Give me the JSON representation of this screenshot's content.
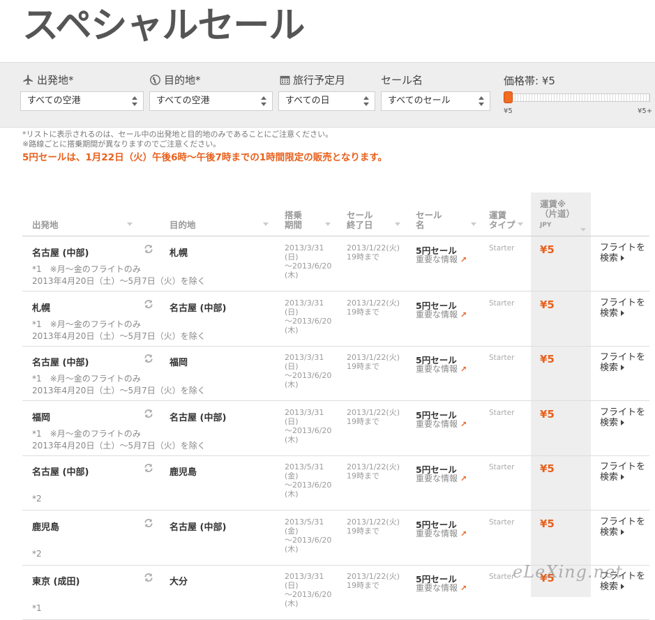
{
  "page_title": "スペシャルセール",
  "filters": {
    "origin": {
      "label": "出発地*",
      "value": "すべての空港"
    },
    "destination": {
      "label": "目的地*",
      "value": "すべての空港"
    },
    "travel_month": {
      "label": "旅行予定月",
      "value": "すべての日"
    },
    "sale_name": {
      "label": "セール名",
      "value": "すべてのセール"
    },
    "price": {
      "label": "価格帯: ¥5",
      "min": "¥5",
      "max": "¥5+",
      "level": 0
    }
  },
  "notes": [
    "*リストに表示されるのは、セール中の出発地と目的地のみであることにご注意ください。",
    "※路線ごとに搭乗期間が異なりますのでご注意ください。"
  ],
  "notice": "5円セールは、1月22日（火）午後6時～午後7時までの1時間限定の販売となります。",
  "table": {
    "headers": {
      "origin": "出発地",
      "destination": "目的地",
      "boarding": [
        "搭乗",
        "期間"
      ],
      "sale_end": [
        "セール",
        "終了日"
      ],
      "sale_name": [
        "セール",
        "名"
      ],
      "fare_type": [
        "運賃",
        "タイプ"
      ],
      "fare": [
        "運賃※",
        "（片道）"
      ],
      "fare_currency": "JPY"
    },
    "rows": [
      {
        "from": "名古屋 (中部)",
        "to": "札幌",
        "note1": "*1　※月～金のフライトのみ",
        "note2": "2013年4月20日（土）～5月7日（火）を除く",
        "board": [
          "2013/3/31",
          "(日)",
          "～2013/6/20",
          "(木)"
        ],
        "end": [
          "2013/1/22(火)",
          "19時まで"
        ],
        "sale": "5円セール",
        "info": "重要な情報",
        "type": "Starter",
        "fare": "¥5",
        "search": [
          "フライトを",
          "検索"
        ]
      },
      {
        "from": "札幌",
        "to": "名古屋 (中部)",
        "note1": "*1　※月～金のフライトのみ",
        "note2": "2013年4月20日（土）～5月7日（火）を除く",
        "board": [
          "2013/3/31",
          "(日)",
          "～2013/6/20",
          "(木)"
        ],
        "end": [
          "2013/1/22(火)",
          "19時まで"
        ],
        "sale": "5円セール",
        "info": "重要な情報",
        "type": "Starter",
        "fare": "¥5",
        "search": [
          "フライトを",
          "検索"
        ]
      },
      {
        "from": "名古屋 (中部)",
        "to": "福岡",
        "note1": "*1　※月～金のフライトのみ",
        "note2": "2013年4月20日（土）～5月7日（火）を除く",
        "board": [
          "2013/3/31",
          "(日)",
          "～2013/6/20",
          "(木)"
        ],
        "end": [
          "2013/1/22(火)",
          "19時まで"
        ],
        "sale": "5円セール",
        "info": "重要な情報",
        "type": "Starter",
        "fare": "¥5",
        "search": [
          "フライトを",
          "検索"
        ]
      },
      {
        "from": "福岡",
        "to": "名古屋 (中部)",
        "note1": "*1　※月～金のフライトのみ",
        "note2": "2013年4月20日（土）～5月7日（火）を除く",
        "board": [
          "2013/3/31",
          "(日)",
          "～2013/6/20",
          "(木)"
        ],
        "end": [
          "2013/1/22(火)",
          "19時まで"
        ],
        "sale": "5円セール",
        "info": "重要な情報",
        "type": "Starter",
        "fare": "¥5",
        "search": [
          "フライトを",
          "検索"
        ]
      },
      {
        "from": "名古屋 (中部)",
        "to": "鹿児島",
        "note1": "",
        "note2": "*2",
        "board": [
          "2013/5/31",
          "(金)",
          "～2013/6/20",
          "(木)"
        ],
        "end": [
          "2013/1/22(火)",
          "19時まで"
        ],
        "sale": "5円セール",
        "info": "重要な情報",
        "type": "Starter",
        "fare": "¥5",
        "search": [
          "フライトを",
          "検索"
        ]
      },
      {
        "from": "鹿児島",
        "to": "名古屋 (中部)",
        "note1": "",
        "note2": "*2",
        "board": [
          "2013/5/31",
          "(金)",
          "～2013/6/20",
          "(木)"
        ],
        "end": [
          "2013/1/22(火)",
          "19時まで"
        ],
        "sale": "5円セール",
        "info": "重要な情報",
        "type": "Starter",
        "fare": "¥5",
        "search": [
          "フライトを",
          "検索"
        ]
      },
      {
        "from": "東京 (成田)",
        "to": "大分",
        "note1": "",
        "note2": "*1",
        "board": [
          "2013/3/31",
          "(日)",
          "～2013/6/20",
          "(木)"
        ],
        "end": [
          "2013/1/22(火)",
          "19時まで"
        ],
        "sale": "5円セール",
        "info": "重要な情報",
        "type": "Starter",
        "fare": "¥5",
        "search": [
          "フライトを",
          "検索"
        ]
      }
    ]
  },
  "watermark": "eLeXing.net"
}
